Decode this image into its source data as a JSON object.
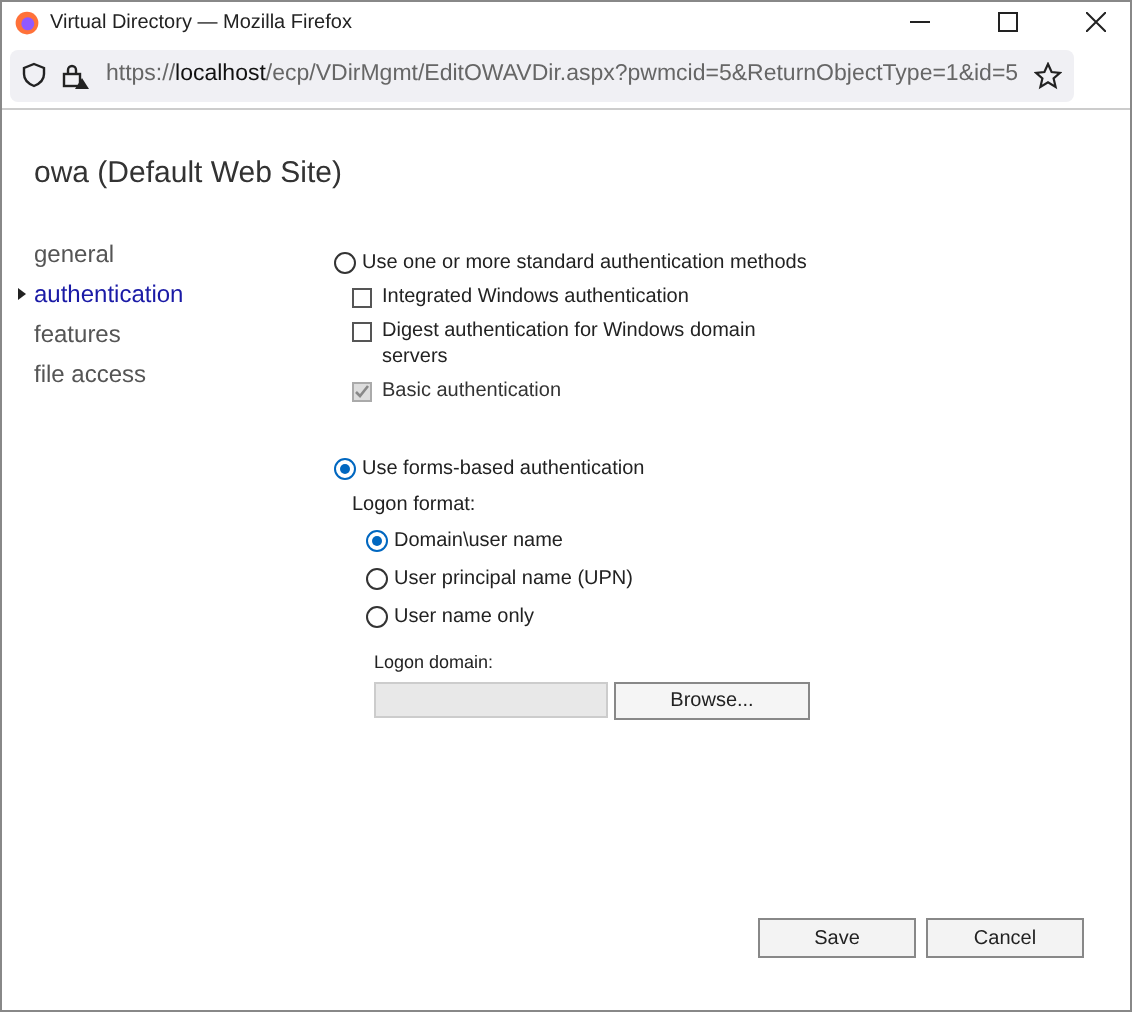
{
  "window": {
    "title": "Virtual Directory — Mozilla Firefox"
  },
  "address_bar": {
    "scheme": "https://",
    "host": "localhost",
    "path": "/ecp/VDirMgmt/EditOWAVDir.aspx?pwmcid=5&ReturnObjectType=1&id=5"
  },
  "page_title": "owa (Default Web Site)",
  "nav": [
    {
      "label": "general",
      "selected": false
    },
    {
      "label": "authentication",
      "selected": true
    },
    {
      "label": "features",
      "selected": false
    },
    {
      "label": "file access",
      "selected": false
    }
  ],
  "standard_auth": {
    "label": "Use one or more standard authentication methods",
    "selected": false,
    "options": [
      {
        "label": "Integrated Windows authentication",
        "checked": false,
        "disabled": false
      },
      {
        "label": "Digest authentication for Windows domain servers",
        "checked": false,
        "disabled": false
      },
      {
        "label": "Basic authentication",
        "checked": true,
        "disabled": true
      }
    ]
  },
  "forms_auth": {
    "label": "Use forms-based authentication",
    "selected": true,
    "logon_format_label": "Logon format:",
    "formats": [
      {
        "label": "Domain\\user name",
        "selected": true
      },
      {
        "label": "User principal name (UPN)",
        "selected": false
      },
      {
        "label": "User name only",
        "selected": false
      }
    ],
    "logon_domain_label": "Logon domain:",
    "browse_button": "Browse..."
  },
  "buttons": [
    "Save",
    "Cancel"
  ]
}
